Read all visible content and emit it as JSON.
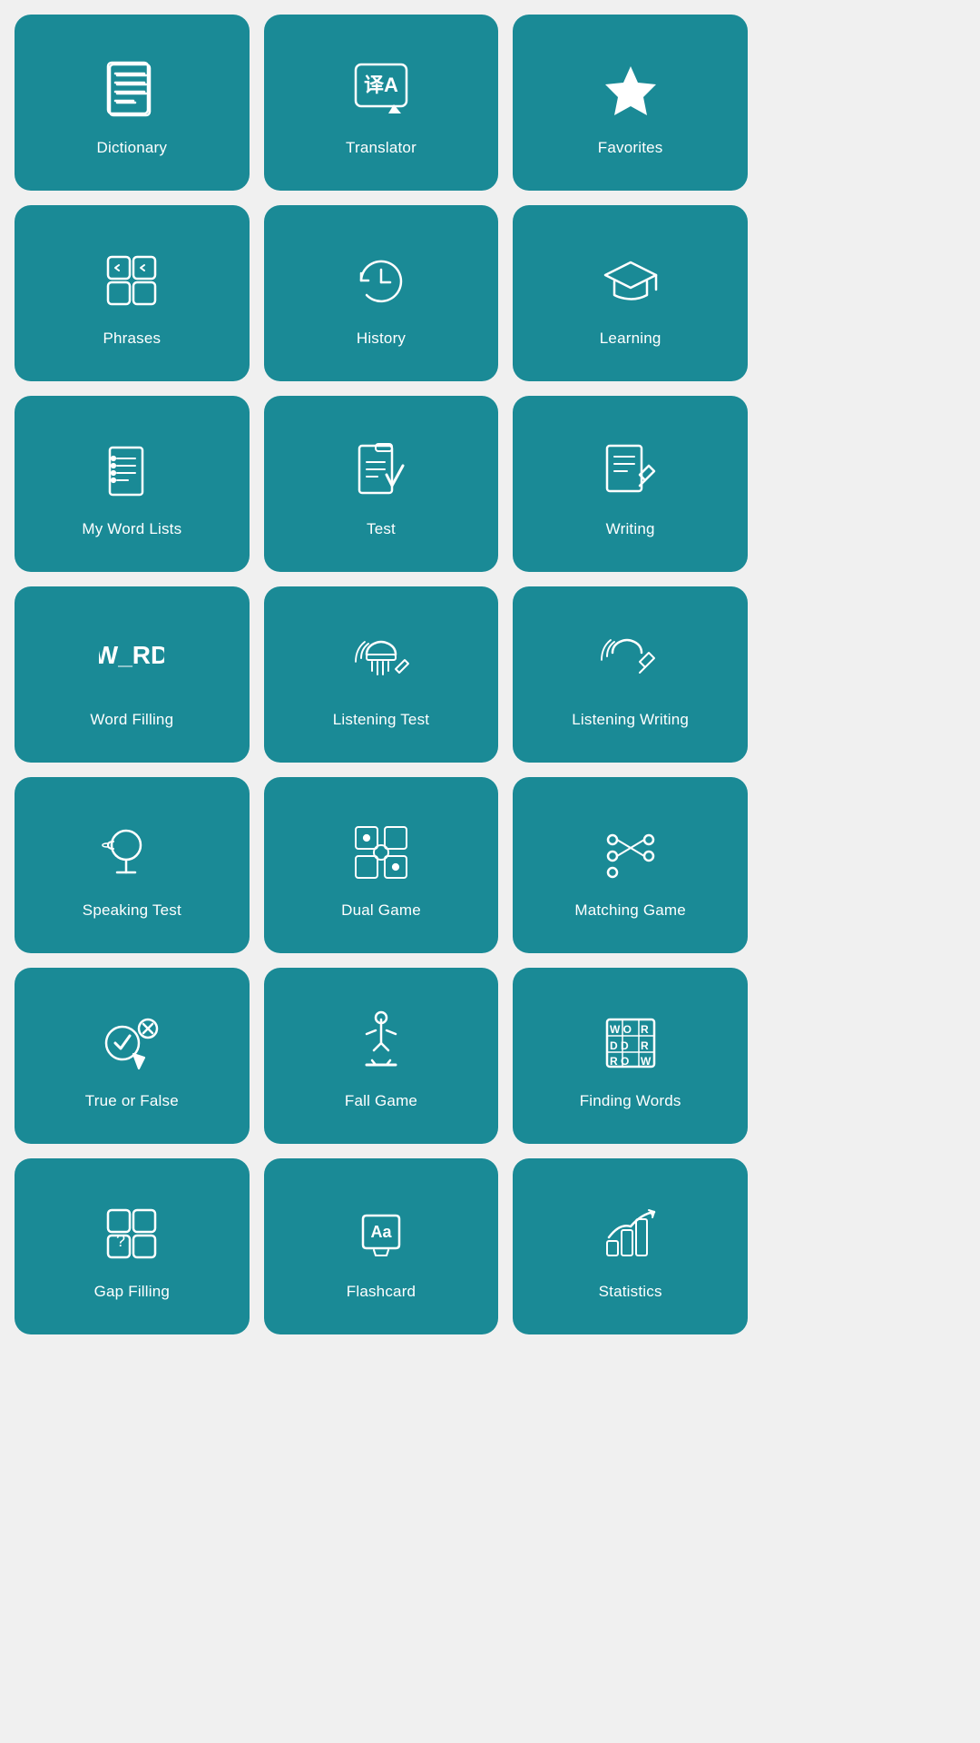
{
  "tiles": [
    {
      "id": "dictionary",
      "label": "Dictionary"
    },
    {
      "id": "translator",
      "label": "Translator"
    },
    {
      "id": "favorites",
      "label": "Favorites"
    },
    {
      "id": "phrases",
      "label": "Phrases"
    },
    {
      "id": "history",
      "label": "History"
    },
    {
      "id": "learning",
      "label": "Learning"
    },
    {
      "id": "my-word-lists",
      "label": "My Word Lists"
    },
    {
      "id": "test",
      "label": "Test"
    },
    {
      "id": "writing",
      "label": "Writing"
    },
    {
      "id": "word-filling",
      "label": "Word Filling"
    },
    {
      "id": "listening-test",
      "label": "Listening Test"
    },
    {
      "id": "listening-writing",
      "label": "Listening Writing"
    },
    {
      "id": "speaking-test",
      "label": "Speaking Test"
    },
    {
      "id": "dual-game",
      "label": "Dual Game"
    },
    {
      "id": "matching-game",
      "label": "Matching Game"
    },
    {
      "id": "true-or-false",
      "label": "True or False"
    },
    {
      "id": "fall-game",
      "label": "Fall Game"
    },
    {
      "id": "finding-words",
      "label": "Finding Words"
    },
    {
      "id": "gap-filling",
      "label": "Gap Filling"
    },
    {
      "id": "flashcard",
      "label": "Flashcard"
    },
    {
      "id": "statistics",
      "label": "Statistics"
    }
  ]
}
